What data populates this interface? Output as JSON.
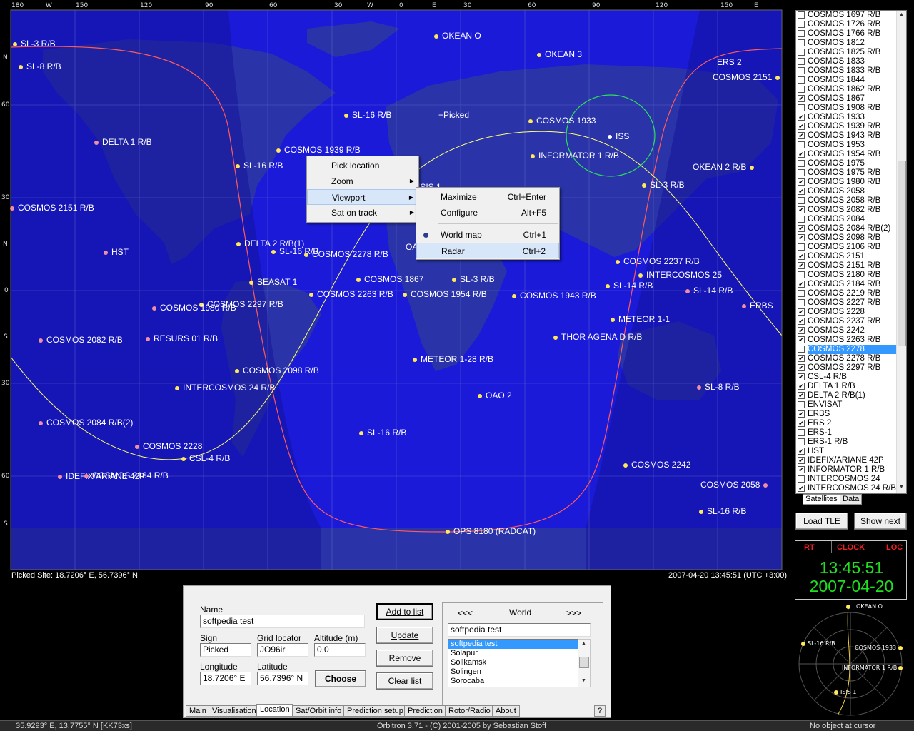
{
  "map": {
    "top_ticks": [
      "180",
      "W",
      "150",
      "120",
      "90",
      "60",
      "30",
      "W",
      "0",
      "E",
      "30",
      "60",
      "90",
      "120",
      "150",
      "E"
    ],
    "left_ticks": [
      "N",
      "60",
      "30",
      "N",
      "0",
      "S",
      "30",
      "60",
      "S"
    ],
    "picked_label": "+Picked",
    "satellites": [
      {
        "name": "SL-3 R/B"
      },
      {
        "name": "SL-8 R/B"
      },
      {
        "name": "OKEAN O"
      },
      {
        "name": "OKEAN 3"
      },
      {
        "name": "ERS 2"
      },
      {
        "name": "COSMOS 2151"
      },
      {
        "name": "SL-16 R/B"
      },
      {
        "name": "COSMOS 1933"
      },
      {
        "name": "ISS"
      },
      {
        "name": "DELTA 1 R/B"
      },
      {
        "name": "COSMOS 1939 R/B"
      },
      {
        "name": "INFORMATOR 1 R/B"
      },
      {
        "name": "SL-16 R/B"
      },
      {
        "name": "OKEAN 2 R/B"
      },
      {
        "name": "SL-3 R/B"
      },
      {
        "name": "COSMOS 2151 R/B"
      },
      {
        "name": "DELTA 2 R/B(1)"
      },
      {
        "name": "SL-16 R/B"
      },
      {
        "name": "COSMOS 2278 R/B"
      },
      {
        "name": "HST"
      },
      {
        "name": "COSMOS 2237 R/B"
      },
      {
        "name": "INTERCOSMOS 25"
      },
      {
        "name": "SEASAT 1"
      },
      {
        "name": "COSMOS 1867"
      },
      {
        "name": "SL-3 R/B"
      },
      {
        "name": "SL-14 R/B"
      },
      {
        "name": "SL-14 R/B"
      },
      {
        "name": "COSMOS 2263 R/B"
      },
      {
        "name": "COSMOS 1954 R/B"
      },
      {
        "name": "COSMOS 1943 R/B"
      },
      {
        "name": "COSMOS 2297 R/B"
      },
      {
        "name": "ERBS"
      },
      {
        "name": "COSMOS 1980 R/B"
      },
      {
        "name": "METEOR 1-1"
      },
      {
        "name": "COSMOS 2082 R/B"
      },
      {
        "name": "RESURS 01 R/B"
      },
      {
        "name": "THOR AGENA D R/B"
      },
      {
        "name": "METEOR 1-28 R/B"
      },
      {
        "name": "COSMOS 2098 R/B"
      },
      {
        "name": "INTERCOSMOS 24 R/B"
      },
      {
        "name": "SL-8 R/B"
      },
      {
        "name": "OAO 2"
      },
      {
        "name": "COSMOS 2084 R/B(2)"
      },
      {
        "name": "SL-16 R/B"
      },
      {
        "name": "COSMOS 2228"
      },
      {
        "name": "CSL-4 R/B"
      },
      {
        "name": "COSMOS 2242"
      },
      {
        "name": "IDEFIX/ARIANE 42P"
      },
      {
        "name": "COSMOS 2184 R/B"
      },
      {
        "name": "COSMOS 2058"
      },
      {
        "name": "SL-16 R/B"
      },
      {
        "name": "OPS 8180 (RADCAT)"
      },
      {
        "name": "OAO"
      },
      {
        "name": "ISIS 1"
      }
    ],
    "picked_site": "Picked Site: 18.7206° E, 56.7396° N",
    "datetime": "2007-04-20 13:45:51 (UTC +3:00)"
  },
  "context_menu": {
    "items": [
      {
        "label": "Pick location",
        "submenu": false
      },
      {
        "label": "Zoom",
        "submenu": true
      },
      {
        "label": "Viewport",
        "submenu": true
      },
      {
        "label": "Sat on track",
        "submenu": true
      }
    ]
  },
  "viewport_submenu": {
    "items": [
      {
        "label": "Maximize",
        "shortcut": "Ctrl+Enter"
      },
      {
        "label": "Configure",
        "shortcut": "Alt+F5"
      },
      {
        "label": "World map",
        "shortcut": "Ctrl+1",
        "selected": true
      },
      {
        "label": "Radar",
        "shortcut": "Ctrl+2"
      }
    ]
  },
  "location": {
    "name_label": "Name",
    "name_value": "softpedia test",
    "sign_label": "Sign",
    "sign_value": "Picked",
    "grid_label": "Grid locator",
    "grid_value": "JO96ir",
    "alt_label": "Altitude (m)",
    "alt_value": "0.0",
    "lon_label": "Longitude",
    "lon_value": "18.7206° E",
    "lat_label": "Latitude",
    "lat_value": "56.7396° N",
    "choose": "Choose",
    "add_to_list": "Add to list",
    "update": "Update",
    "remove": "Remove",
    "clear_list": "Clear list",
    "prev": "<<<",
    "region": "World",
    "next": ">>>",
    "search_value": "softpedia test",
    "cities": [
      "softpedia test",
      "Solapur",
      "Solikamsk",
      "Solingen",
      "Sorocaba"
    ],
    "tabs": [
      "Main",
      "Visualisation",
      "Location",
      "Sat/Orbit info",
      "Prediction setup",
      "Prediction",
      "Rotor/Radio",
      "About",
      "?"
    ]
  },
  "sat_panel": {
    "list": [
      {
        "name": "COSMOS 1697 R/B",
        "checked": false
      },
      {
        "name": "COSMOS 1726 R/B",
        "checked": false
      },
      {
        "name": "COSMOS 1766 R/B",
        "checked": false
      },
      {
        "name": "COSMOS 1812",
        "checked": false
      },
      {
        "name": "COSMOS 1825 R/B",
        "checked": false
      },
      {
        "name": "COSMOS 1833",
        "checked": false
      },
      {
        "name": "COSMOS 1833 R/B",
        "checked": false
      },
      {
        "name": "COSMOS 1844",
        "checked": false
      },
      {
        "name": "COSMOS 1862 R/B",
        "checked": false
      },
      {
        "name": "COSMOS 1867",
        "checked": true
      },
      {
        "name": "COSMOS 1908 R/B",
        "checked": false
      },
      {
        "name": "COSMOS 1933",
        "checked": true
      },
      {
        "name": "COSMOS 1939 R/B",
        "checked": true
      },
      {
        "name": "COSMOS 1943 R/B",
        "checked": true
      },
      {
        "name": "COSMOS 1953",
        "checked": false
      },
      {
        "name": "COSMOS 1954 R/B",
        "checked": true
      },
      {
        "name": "COSMOS 1975",
        "checked": false
      },
      {
        "name": "COSMOS 1975 R/B",
        "checked": false
      },
      {
        "name": "COSMOS 1980 R/B",
        "checked": true
      },
      {
        "name": "COSMOS 2058",
        "checked": true
      },
      {
        "name": "COSMOS 2058 R/B",
        "checked": false
      },
      {
        "name": "COSMOS 2082 R/B",
        "checked": true
      },
      {
        "name": "COSMOS 2084",
        "checked": false
      },
      {
        "name": "COSMOS 2084 R/B(2)",
        "checked": true
      },
      {
        "name": "COSMOS 2098 R/B",
        "checked": true
      },
      {
        "name": "COSMOS 2106 R/B",
        "checked": false
      },
      {
        "name": "COSMOS 2151",
        "checked": true
      },
      {
        "name": "COSMOS 2151 R/B",
        "checked": true
      },
      {
        "name": "COSMOS 2180 R/B",
        "checked": false
      },
      {
        "name": "COSMOS 2184 R/B",
        "checked": true
      },
      {
        "name": "COSMOS 2219 R/B",
        "checked": false
      },
      {
        "name": "COSMOS 2227 R/B",
        "checked": false
      },
      {
        "name": "COSMOS 2228",
        "checked": true
      },
      {
        "name": "COSMOS 2237 R/B",
        "checked": true
      },
      {
        "name": "COSMOS 2242",
        "checked": true
      },
      {
        "name": "COSMOS 2263 R/B",
        "checked": true
      },
      {
        "name": "COSMOS 2278",
        "checked": false,
        "selected": true
      },
      {
        "name": "COSMOS 2278 R/B",
        "checked": true
      },
      {
        "name": "COSMOS 2297 R/B",
        "checked": true
      },
      {
        "name": "CSL-4 R/B",
        "checked": true
      },
      {
        "name": "DELTA 1 R/B",
        "checked": true
      },
      {
        "name": "DELTA 2 R/B(1)",
        "checked": true
      },
      {
        "name": "ENVISAT",
        "checked": false
      },
      {
        "name": "ERBS",
        "checked": true
      },
      {
        "name": "ERS 2",
        "checked": true
      },
      {
        "name": "ERS-1",
        "checked": false
      },
      {
        "name": "ERS-1 R/B",
        "checked": false
      },
      {
        "name": "HST",
        "checked": true
      },
      {
        "name": "IDEFIX/ARIANE 42P",
        "checked": true
      },
      {
        "name": "INFORMATOR 1 R/B",
        "checked": true
      },
      {
        "name": "INTERCOSMOS 24",
        "checked": false
      },
      {
        "name": "INTERCOSMOS 24 R/B",
        "checked": true
      }
    ],
    "tabs": [
      "Satellites",
      "Data"
    ],
    "load_tle": "Load TLE",
    "show_next": "Show next"
  },
  "clock": {
    "rt": "RT",
    "clock": "CLOCK",
    "loc": "LOC",
    "time": "13:45:51",
    "date": "2007-04-20"
  },
  "radar": {
    "labels": [
      "OKEAN O",
      "SL-16 R/B",
      "COSMOS 1933",
      "INFORMATOR 1 R/B",
      "ISIS 1"
    ]
  },
  "statusbar": {
    "coords": "35.9293° E, 13.7755° N [KK73xs]",
    "app": "Orbitron 3.71 - (C) 2001-2005 by Sebastian Stoff",
    "cursor": "No object at cursor"
  },
  "colors": {
    "ocean": "#1a1ad8",
    "land": "#2a34a8",
    "night": "#14149a",
    "sat_yellow": "#ffe95a",
    "sat_pink": "#f28da6"
  }
}
